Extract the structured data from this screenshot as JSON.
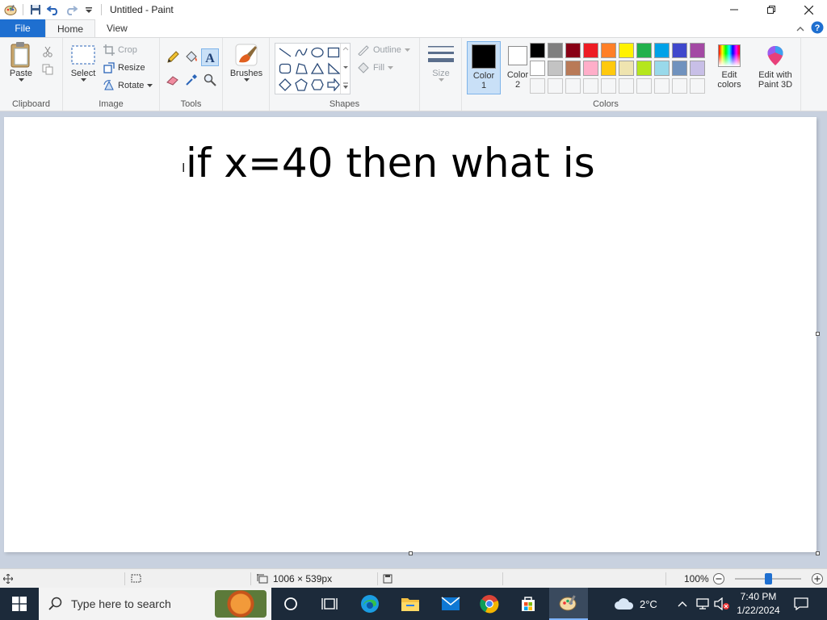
{
  "window": {
    "title": "Untitled - Paint"
  },
  "tabs": [
    {
      "label": "File"
    },
    {
      "label": "Home"
    },
    {
      "label": "View"
    }
  ],
  "ribbon": {
    "clipboard": {
      "label": "Clipboard",
      "paste": "Paste"
    },
    "image": {
      "label": "Image",
      "select": "Select",
      "crop": "Crop",
      "resize": "Resize",
      "rotate": "Rotate"
    },
    "tools": {
      "label": "Tools"
    },
    "brushes": {
      "label": "Brushes"
    },
    "shapes": {
      "label": "Shapes",
      "outline": "Outline",
      "fill": "Fill"
    },
    "size": {
      "label": "Size"
    },
    "colors": {
      "label": "Colors",
      "color1_line1": "Color",
      "color1_line2": "1",
      "color2_line1": "Color",
      "color2_line2": "2",
      "edit_line1": "Edit",
      "edit_line2": "colors",
      "paint3d_line1": "Edit with",
      "paint3d_line2": "Paint 3D",
      "color1_value": "#000000",
      "color2_value": "#ffffff",
      "palette": [
        "#000000",
        "#7f7f7f",
        "#880015",
        "#ed1c24",
        "#ff7f27",
        "#fff200",
        "#22b14c",
        "#00a2e8",
        "#3f48cc",
        "#a349a4",
        "#ffffff",
        "#c3c3c3",
        "#b97a57",
        "#ffaec9",
        "#ffc90e",
        "#efe4b0",
        "#b5e61d",
        "#99d9ea",
        "#7092be",
        "#c8bfe7",
        "#f5f6f7",
        "#f5f6f7",
        "#f5f6f7",
        "#f5f6f7",
        "#f5f6f7",
        "#f5f6f7",
        "#f5f6f7",
        "#f5f6f7",
        "#f5f6f7",
        "#f5f6f7"
      ]
    }
  },
  "canvas": {
    "text": "if x=40 then what is"
  },
  "statusbar": {
    "dimensions": "1006 × 539px",
    "zoom": "100%",
    "zoom_level": 0.5
  },
  "taskbar": {
    "search_placeholder": "Type here to search",
    "weather": "2°C",
    "time": "7:40 PM",
    "date": "1/22/2024"
  },
  "accent_color": "#1e6fd0"
}
